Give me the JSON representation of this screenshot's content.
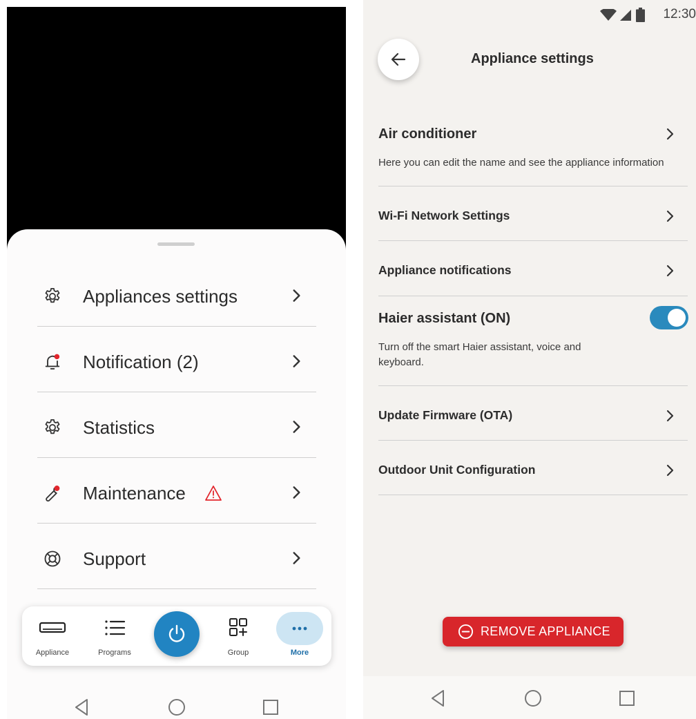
{
  "left": {
    "menu": [
      {
        "label": "Appliances settings",
        "icon": "gear-icon"
      },
      {
        "label": "Notification (2)",
        "icon": "bell-icon"
      },
      {
        "label": "Statistics",
        "icon": "gear-icon"
      },
      {
        "label": "Maintenance",
        "icon": "wrench-icon"
      },
      {
        "label": "Support",
        "icon": "lifebuoy-icon"
      }
    ],
    "tabs": {
      "appliance": "Appliance",
      "programs": "Programs",
      "group": "Group",
      "more": "More"
    }
  },
  "right": {
    "status_time": "12:30",
    "title": "Appliance settings",
    "air_conditioner": {
      "label": "Air conditioner",
      "sub": "Here you can edit the name and see the appliance information"
    },
    "wifi": "Wi-Fi Network Settings",
    "notifications": "Appliance notifications",
    "assistant": {
      "label": "Haier assistant (ON)",
      "sub": "Turn off the smart Haier assistant, voice and keyboard.",
      "enabled": true
    },
    "firmware": "Update Firmware (OTA)",
    "outdoor": "Outdoor Unit Configuration",
    "remove_label": "REMOVE APPLIANCE"
  },
  "colors": {
    "accent_blue": "#2184c2",
    "danger_red": "#d8262b",
    "alert_dot": "#e2262d"
  }
}
